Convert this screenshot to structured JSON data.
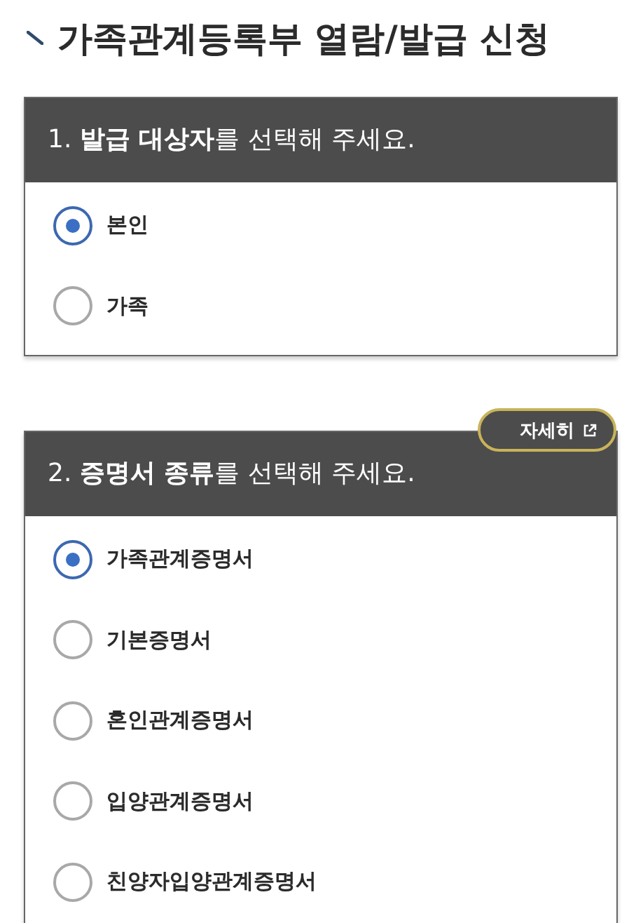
{
  "page_title": "가족관계등록부 열람/발급 신청",
  "sections": [
    {
      "heading": "1. **발급 대상자**를 선택해 주세요.",
      "options": [
        {
          "label": "본인",
          "selected": true
        },
        {
          "label": "가족",
          "selected": false
        }
      ]
    },
    {
      "heading": "2. **증명서 종류**를 선택해 주세요.",
      "detail_button": "자세히",
      "options": [
        {
          "label": "가족관계증명서",
          "selected": true
        },
        {
          "label": "기본증명서",
          "selected": false
        },
        {
          "label": "혼인관계증명서",
          "selected": false
        },
        {
          "label": "입양관계증명서",
          "selected": false
        },
        {
          "label": "친양자입양관계증명서",
          "selected": false
        }
      ]
    }
  ]
}
